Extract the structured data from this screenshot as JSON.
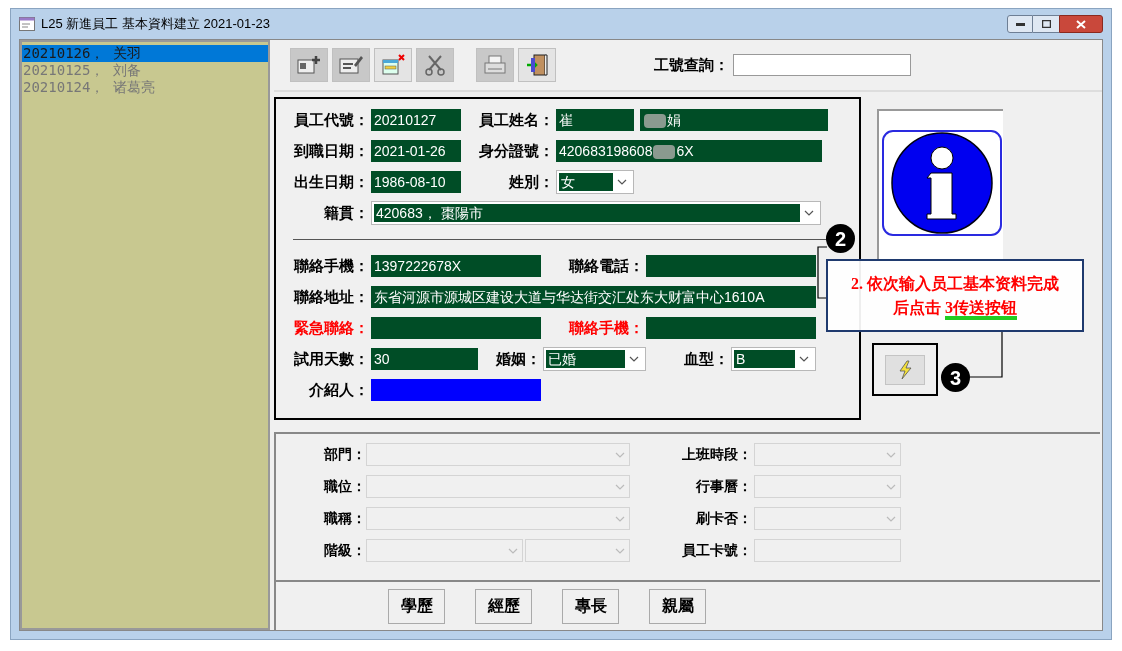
{
  "window": {
    "title": "L25 新進員工 基本資料建立  2021-01-23"
  },
  "sidebar": {
    "items": [
      {
        "label": "20210126， 关羽",
        "selected": true
      },
      {
        "label": "20210125， 刘备",
        "selected": false
      },
      {
        "label": "20210124， 诸葛亮",
        "selected": false
      }
    ]
  },
  "search": {
    "label": "工號查詢："
  },
  "form": {
    "sections": [
      {
        "rows": [
          {
            "fields": [
              {
                "label": "員工代號：",
                "kind": "text",
                "segments": [
                  {
                    "kind": "text",
                    "text": "20210127"
                  }
                ]
              },
              {
                "label": "員工姓名：",
                "kind": "text",
                "segments": [
                  {
                    "kind": "text",
                    "text": "崔"
                  }
                ]
              },
              {
                "kind": "text",
                "segments": [
                  {
                    "kind": "redacted"
                  },
                  {
                    "kind": "text",
                    "text": "娟"
                  }
                ]
              }
            ]
          },
          {
            "fields": [
              {
                "label": "到職日期：",
                "kind": "text",
                "segments": [
                  {
                    "kind": "text",
                    "text": "2021-01-26"
                  }
                ]
              },
              {
                "label": "身分證號：",
                "kind": "text",
                "segments": [
                  {
                    "kind": "text",
                    "text": "420683198608"
                  },
                  {
                    "kind": "redacted"
                  },
                  {
                    "kind": "text",
                    "text": "6X"
                  }
                ]
              }
            ]
          },
          {
            "fields": [
              {
                "label": "出生日期：",
                "kind": "text",
                "segments": [
                  {
                    "kind": "text",
                    "text": "1986-08-10"
                  }
                ]
              },
              {
                "label": "姓別：",
                "kind": "select",
                "segments": [
                  {
                    "kind": "text",
                    "text": "女"
                  }
                ]
              }
            ]
          },
          {
            "fields": [
              {
                "label": "籍貫：",
                "kind": "select",
                "segments": [
                  {
                    "kind": "text",
                    "text": "420683， 棗陽市"
                  }
                ]
              }
            ]
          }
        ]
      },
      {
        "rows": [
          {
            "fields": [
              {
                "label": "聯絡手機：",
                "kind": "text",
                "segments": [
                  {
                    "kind": "text",
                    "text": "1397222678X"
                  }
                ]
              },
              {
                "label": "聯絡電話：",
                "kind": "text"
              }
            ]
          },
          {
            "fields": [
              {
                "label": "聯絡地址：",
                "kind": "text",
                "segments": [
                  {
                    "kind": "text",
                    "text": "东省河源市源城区建设大道与华达街交汇处东大财富中心1610A"
                  }
                ]
              }
            ]
          },
          {
            "fields": [
              {
                "label": "緊急聯絡：",
                "alert": true,
                "kind": "text"
              },
              {
                "label": "聯絡手機：",
                "alert": true,
                "kind": "text"
              }
            ]
          },
          {
            "fields": [
              {
                "label": "試用天數：",
                "kind": "text",
                "segments": [
                  {
                    "kind": "text",
                    "text": "30"
                  }
                ]
              },
              {
                "label": "婚姻：",
                "kind": "select",
                "segments": [
                  {
                    "kind": "text",
                    "text": "已婚"
                  }
                ]
              },
              {
                "label": "血型：",
                "kind": "select",
                "segments": [
                  {
                    "kind": "text",
                    "text": "B"
                  }
                ]
              }
            ]
          },
          {
            "fields": [
              {
                "label": "介紹人：",
                "kind": "text",
                "highlighted": true
              }
            ]
          }
        ]
      }
    ]
  },
  "lower": {
    "left": [
      {
        "label": "部門：",
        "kind": "select"
      },
      {
        "label": "職位：",
        "kind": "select"
      },
      {
        "label": "職稱：",
        "kind": "select"
      },
      {
        "label": "階級：",
        "kind": "select_pair"
      }
    ],
    "right": [
      {
        "label": "上班時段：",
        "kind": "select"
      },
      {
        "label": "行事曆：",
        "kind": "select"
      },
      {
        "label": "刷卡否：",
        "kind": "select"
      },
      {
        "label": "員工卡號：",
        "kind": "text"
      }
    ]
  },
  "buttons": [
    "學歷",
    "經歷",
    "專長",
    "親屬"
  ],
  "annotation": {
    "badges": [
      "2",
      "3"
    ],
    "text": "2. 依次输入员工基本资料完成后点击 ",
    "underlined": "3传送按钮"
  }
}
